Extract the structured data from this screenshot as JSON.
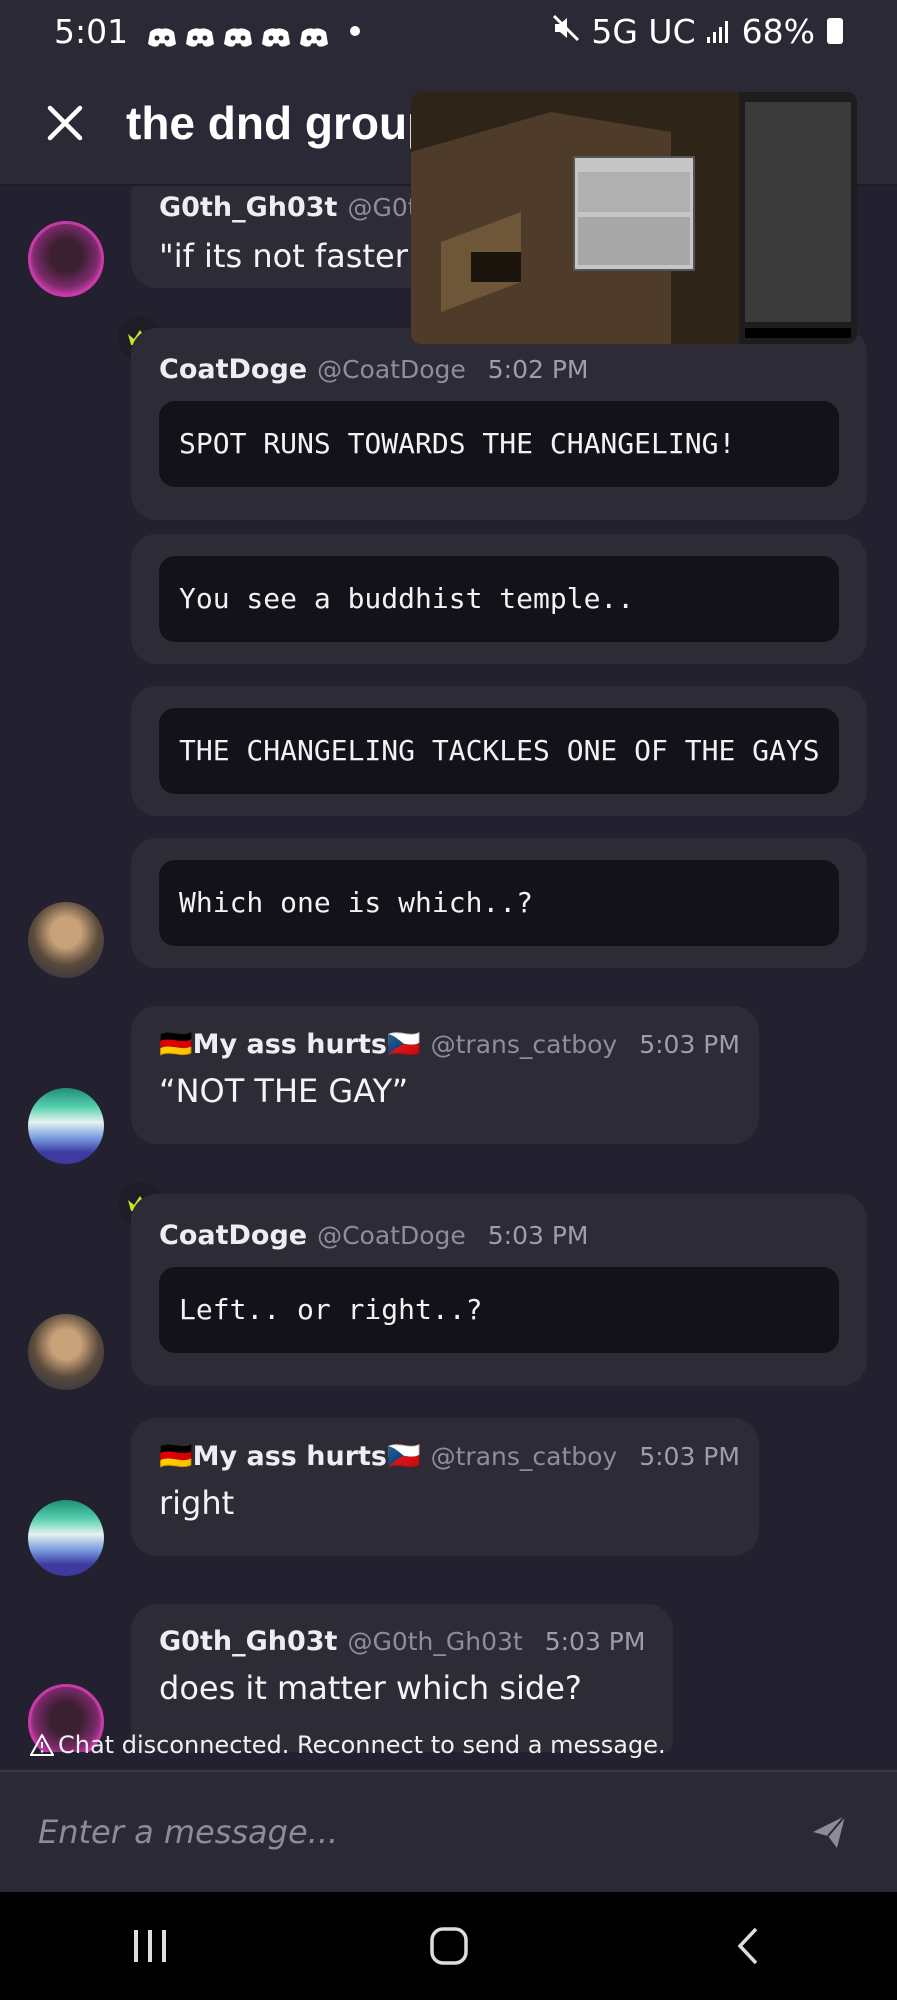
{
  "status_bar": {
    "time": "5:01",
    "network": "5G UC",
    "battery": "68%",
    "notification_icons": [
      "discord-icon",
      "discord-icon",
      "discord-icon",
      "discord-icon",
      "discord-icon"
    ]
  },
  "header": {
    "title": "the dnd group",
    "close_icon": "close-icon"
  },
  "pip": {
    "label": "picture-in-picture video"
  },
  "messages": [
    {
      "author": "G0th_Gh03t",
      "handle": "@G0th_Gh03t",
      "text": "\"if its not faster"
    },
    {
      "author": "CoatDoge",
      "handle": "@CoatDoge",
      "time": "5:02 PM",
      "code": "SPOT RUNS TOWARDS THE CHANGELING!"
    },
    {
      "code": "You see a buddhist temple.."
    },
    {
      "code": "THE CHANGELING TACKLES ONE OF THE GAYS"
    },
    {
      "code": "Which one is which..?"
    },
    {
      "author": "🇩🇪My ass hurts🇨🇿",
      "handle": "@trans_catboy",
      "time": "5:03 PM",
      "text": "“NOT THE GAY”"
    },
    {
      "author": "CoatDoge",
      "handle": "@CoatDoge",
      "time": "5:03 PM",
      "code": "Left.. or right..?"
    },
    {
      "author": "🇩🇪My ass hurts🇨🇿",
      "handle": "@trans_catboy",
      "time": "5:03 PM",
      "text": "right"
    },
    {
      "author": "G0th_Gh03t",
      "handle": "@G0th_Gh03t",
      "time": "5:03 PM",
      "text": "does it matter which side?"
    }
  ],
  "notice": "Chat disconnected. Reconnect to send a message.",
  "composer": {
    "placeholder": "Enter a message..."
  },
  "navbar": {
    "recents": "recents-icon",
    "home": "home-icon",
    "back": "back-icon"
  },
  "colors": {
    "background": "#232030",
    "bubble": "#2d2b36",
    "code_block": "#13121a",
    "crown": "#c6e62a"
  }
}
